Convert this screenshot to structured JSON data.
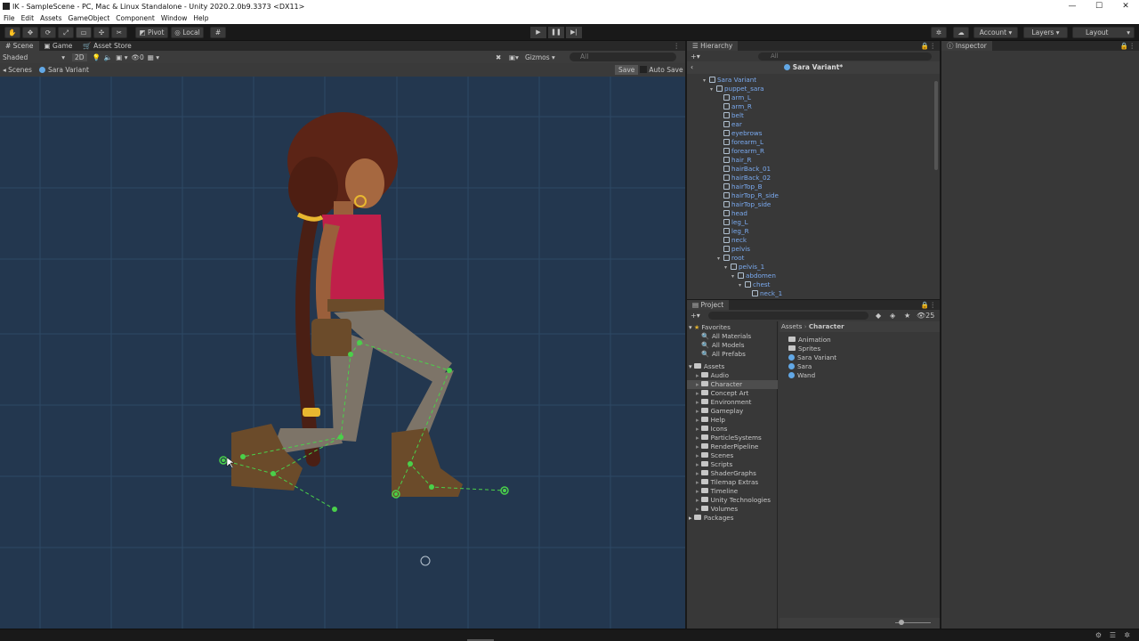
{
  "window": {
    "title": "IK - SampleScene - PC, Mac & Linux Standalone - Unity 2020.2.0b9.3373 <DX11>"
  },
  "menu": [
    "File",
    "Edit",
    "Assets",
    "GameObject",
    "Component",
    "Window",
    "Help"
  ],
  "toolbar": {
    "pivot": "Pivot",
    "local": "Local",
    "account": "Account",
    "layers": "Layers",
    "layout": "Layout"
  },
  "scene_tabs": [
    "Scene",
    "Game",
    "Asset Store"
  ],
  "scene_controls": {
    "shading": "Shaded",
    "mode_2d": "2D",
    "hidden_count": "0",
    "gizmos": "Gizmos",
    "search_placeholder": "All"
  },
  "breadcrumb": {
    "scenes": "Scenes",
    "object": "Sara Variant",
    "save": "Save",
    "autosave": "Auto Save"
  },
  "hierarchy": {
    "title": "Hierarchy",
    "search_placeholder": "All",
    "header": "Sara Variant*",
    "rows": [
      {
        "label": "Sara Variant",
        "depth": 0,
        "expanded": true
      },
      {
        "label": "puppet_sara",
        "depth": 1,
        "expanded": true
      },
      {
        "label": "arm_L",
        "depth": 2
      },
      {
        "label": "arm_R",
        "depth": 2
      },
      {
        "label": "belt",
        "depth": 2
      },
      {
        "label": "ear",
        "depth": 2
      },
      {
        "label": "eyebrows",
        "depth": 2
      },
      {
        "label": "forearm_L",
        "depth": 2
      },
      {
        "label": "forearm_R",
        "depth": 2
      },
      {
        "label": "hair_R",
        "depth": 2
      },
      {
        "label": "hairBack_01",
        "depth": 2
      },
      {
        "label": "hairBack_02",
        "depth": 2
      },
      {
        "label": "hairTop_B",
        "depth": 2
      },
      {
        "label": "hairTop_R_side",
        "depth": 2
      },
      {
        "label": "hairTop_side",
        "depth": 2
      },
      {
        "label": "head",
        "depth": 2
      },
      {
        "label": "leg_L",
        "depth": 2
      },
      {
        "label": "leg_R",
        "depth": 2
      },
      {
        "label": "neck",
        "depth": 2
      },
      {
        "label": "pelvis",
        "depth": 2
      },
      {
        "label": "root",
        "depth": 2,
        "expanded": true
      },
      {
        "label": "pelvis_1",
        "depth": 3,
        "expanded": true
      },
      {
        "label": "abdomen",
        "depth": 4,
        "expanded": true
      },
      {
        "label": "chest",
        "depth": 5,
        "expanded": true
      },
      {
        "label": "neck_1",
        "depth": 6
      }
    ]
  },
  "project": {
    "title": "Project",
    "count": "25",
    "favorites_label": "Favorites",
    "favorites": [
      "All Materials",
      "All Models",
      "All Prefabs"
    ],
    "assets_label": "Assets",
    "folders": [
      "Audio",
      "Character",
      "Concept Art",
      "Environment",
      "Gameplay",
      "Help",
      "Icons",
      "ParticleSystems",
      "RenderPipeline",
      "Scenes",
      "Scripts",
      "ShaderGraphs",
      "Tilemap Extras",
      "Timeline",
      "Unity Technologies",
      "Volumes"
    ],
    "selected_folder": "Character",
    "packages_label": "Packages",
    "path": [
      "Assets",
      "Character"
    ],
    "contents": [
      {
        "label": "Animation",
        "kind": "folder"
      },
      {
        "label": "Sprites",
        "kind": "folder"
      },
      {
        "label": "Sara Variant",
        "kind": "prefab"
      },
      {
        "label": "Sara",
        "kind": "prefab"
      },
      {
        "label": "Wand",
        "kind": "prefab"
      }
    ]
  },
  "inspector": {
    "title": "Inspector"
  }
}
